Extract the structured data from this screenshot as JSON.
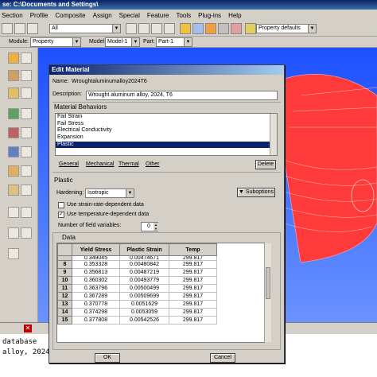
{
  "window": {
    "title": "se: C:\\Documents and Settings\\"
  },
  "menu": [
    "Section",
    "Profile",
    "Composite",
    "Assign",
    "Special",
    "Feature",
    "Tools",
    "Plug-ins",
    "Help"
  ],
  "toolbar": {
    "selection_combo": "All",
    "render_combo": "Property defaults"
  },
  "context": {
    "module_label": "Module:",
    "module_value": "Property",
    "model_label": "Model:",
    "model_value": "Model-1",
    "part_label": "Part:",
    "part_value": "Part-1"
  },
  "dialog": {
    "title": "Edit Material",
    "name_label": "Name:",
    "name_value": "Wroughtaluminumalloy2024T6",
    "desc_label": "Description:",
    "desc_value": "Wrought aluminum alloy, 2024, T6",
    "behaviors_head": "Material Behaviors",
    "behaviors": [
      "Fail Strain",
      "Fail Stress",
      "Electrical Conductivity",
      "Expansion",
      "Plastic"
    ],
    "selected_behavior": "Plastic",
    "behavior_menus": [
      "General",
      "Mechanical",
      "Thermal",
      "Other"
    ],
    "delete_label": "Delete",
    "plastic_head": "Plastic",
    "hardening_label": "Hardening:",
    "hardening_value": "Isotropic",
    "suboptions_label": "Suboptions",
    "strain_rate_label": "Use strain-rate-dependent data",
    "temp_dep_label": "Use temperature-dependent data",
    "field_vars_label": "Number of field variables:",
    "field_vars_value": "0",
    "data_head": "Data",
    "columns": [
      "Yield Stress",
      "Plastic Strain",
      "Temp"
    ],
    "partial_row": [
      "0.349045",
      "0.00474671",
      "299.817"
    ],
    "rows": [
      [
        "8",
        "0.353328",
        "0.00480842",
        "299.817"
      ],
      [
        "9",
        "0.356813",
        "0.00487219",
        "299.817"
      ],
      [
        "10",
        "0.360302",
        "0.00493779",
        "299.817"
      ],
      [
        "11",
        "0.363796",
        "0.00500499",
        "299.817"
      ],
      [
        "12",
        "0.367289",
        "0.00509699",
        "299.817"
      ],
      [
        "13",
        "0.370778",
        "0.0051629",
        "299.817"
      ],
      [
        "14",
        "0.374298",
        "0.0053059",
        "299.817"
      ],
      [
        "15",
        "0.377808",
        "0.00542526",
        "299.817"
      ]
    ],
    "ok_label": "OK",
    "cancel_label": "Cancel"
  },
  "messages": [
    "database",
    "alloy, 2024,"
  ],
  "colors": {
    "viewport_blue": "#2a5cff",
    "mesh_red": "#ff2a2a",
    "title_blue": "#0a246a"
  }
}
